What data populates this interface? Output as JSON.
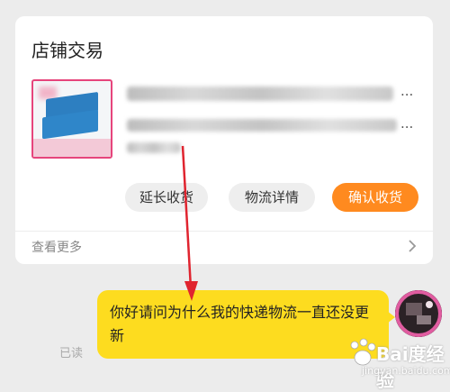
{
  "order_card": {
    "title": "店铺交易",
    "product_thumb_label": "",
    "ellipsis": "...",
    "buttons": {
      "extend": "延长收货",
      "logistics": "物流详情",
      "confirm": "确认收货"
    },
    "view_more": "查看更多"
  },
  "chat": {
    "read_status": "已读",
    "message": "你好请问为什么我的快递物流一直还没更新"
  },
  "colors": {
    "accent": "#ff8a1f",
    "bubble": "#fddc1f",
    "annotation_arrow": "#e0242f"
  },
  "watermark": {
    "brand": "Bai度经验",
    "url": "jingyan.baidu.com"
  }
}
